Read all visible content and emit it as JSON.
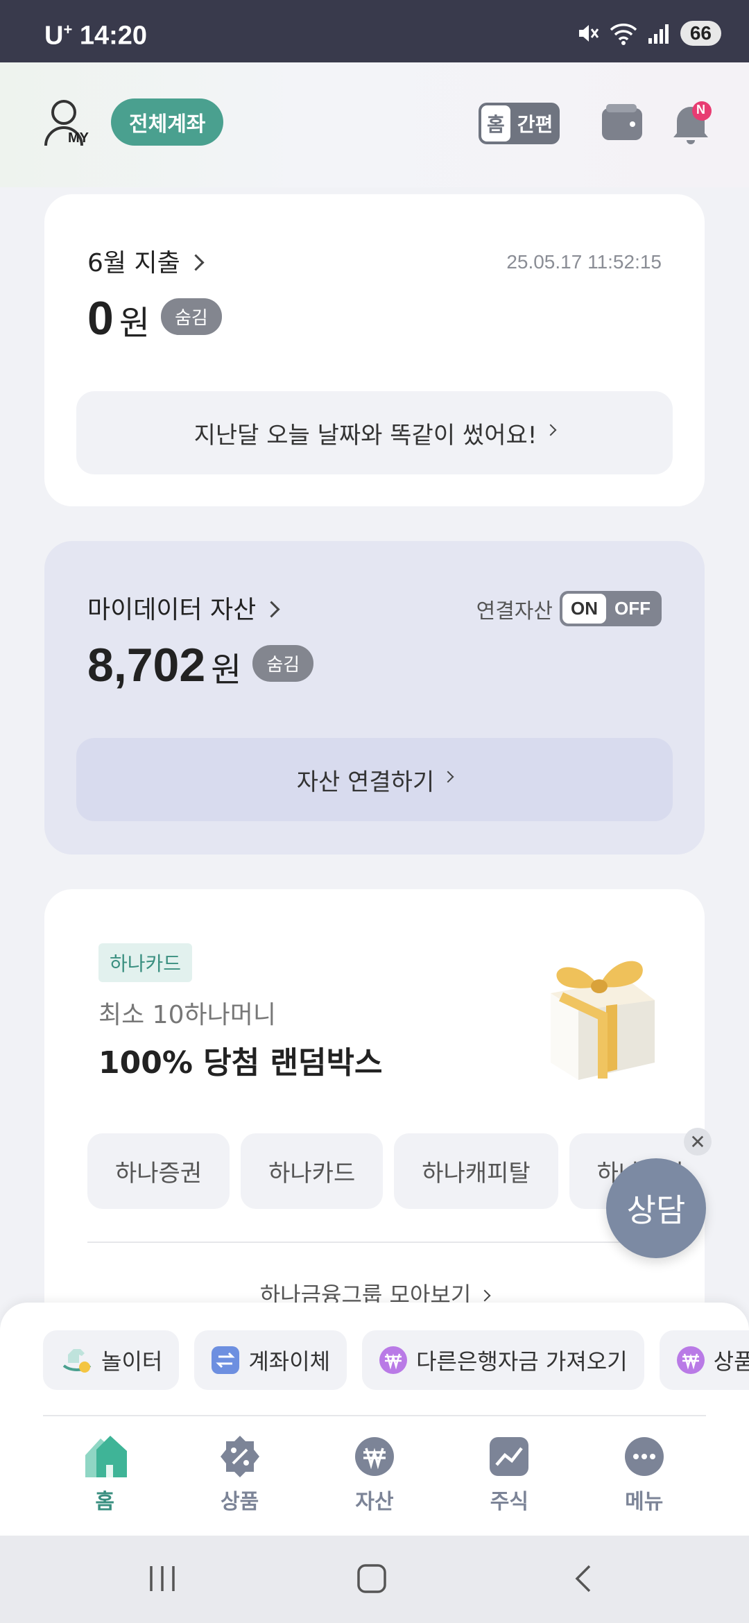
{
  "status_bar": {
    "carrier": "U",
    "carrier_sup": "+",
    "time": "14:20",
    "battery": "66"
  },
  "header": {
    "my_label": "MY",
    "all_accounts": "전체계좌",
    "home_badge": "홈",
    "simple_label": "간편",
    "notification_badge": "N"
  },
  "spending_card": {
    "title": "6월 지출",
    "timestamp": "25.05.17 11:52:15",
    "amount": "0",
    "unit": "원",
    "hide_badge": "숨김",
    "compare_button": "지난달 오늘 날짜와 똑같이 썼어요!"
  },
  "asset_card": {
    "title": "마이데이터 자산",
    "linked_label": "연결자산",
    "toggle_on": "ON",
    "toggle_off": "OFF",
    "amount": "8,702",
    "unit": "원",
    "hide_badge": "숨김",
    "connect_button": "자산 연결하기"
  },
  "promo_card": {
    "tag": "하나카드",
    "subtitle": "최소 10하나머니",
    "title": "100% 당첨 랜덤박스",
    "chips": [
      "하나증권",
      "하나카드",
      "하나캐피탈",
      "하나생명"
    ],
    "more_link": "하나금융그룹 모아보기"
  },
  "consult_button": {
    "label": "상담"
  },
  "quick_actions": [
    {
      "label": "놀이터",
      "icon": "rocking-horse-icon"
    },
    {
      "label": "계좌이체",
      "icon": "transfer-icon"
    },
    {
      "label": "다른은행자금 가져오기",
      "icon": "won-coin-icon"
    },
    {
      "label": "상품",
      "icon": "won-coin-icon"
    }
  ],
  "bottom_nav": [
    {
      "label": "홈",
      "icon": "home-icon",
      "active": true
    },
    {
      "label": "상품",
      "icon": "percent-badge-icon",
      "active": false
    },
    {
      "label": "자산",
      "icon": "won-circle-icon",
      "active": false
    },
    {
      "label": "주식",
      "icon": "chart-icon",
      "active": false
    },
    {
      "label": "메뉴",
      "icon": "more-icon",
      "active": false
    }
  ],
  "colors": {
    "accent": "#4aa08f",
    "status_bar": "#393a4c",
    "asset_card_bg": "#e4e6f2",
    "consult": "#7c8aa3"
  }
}
